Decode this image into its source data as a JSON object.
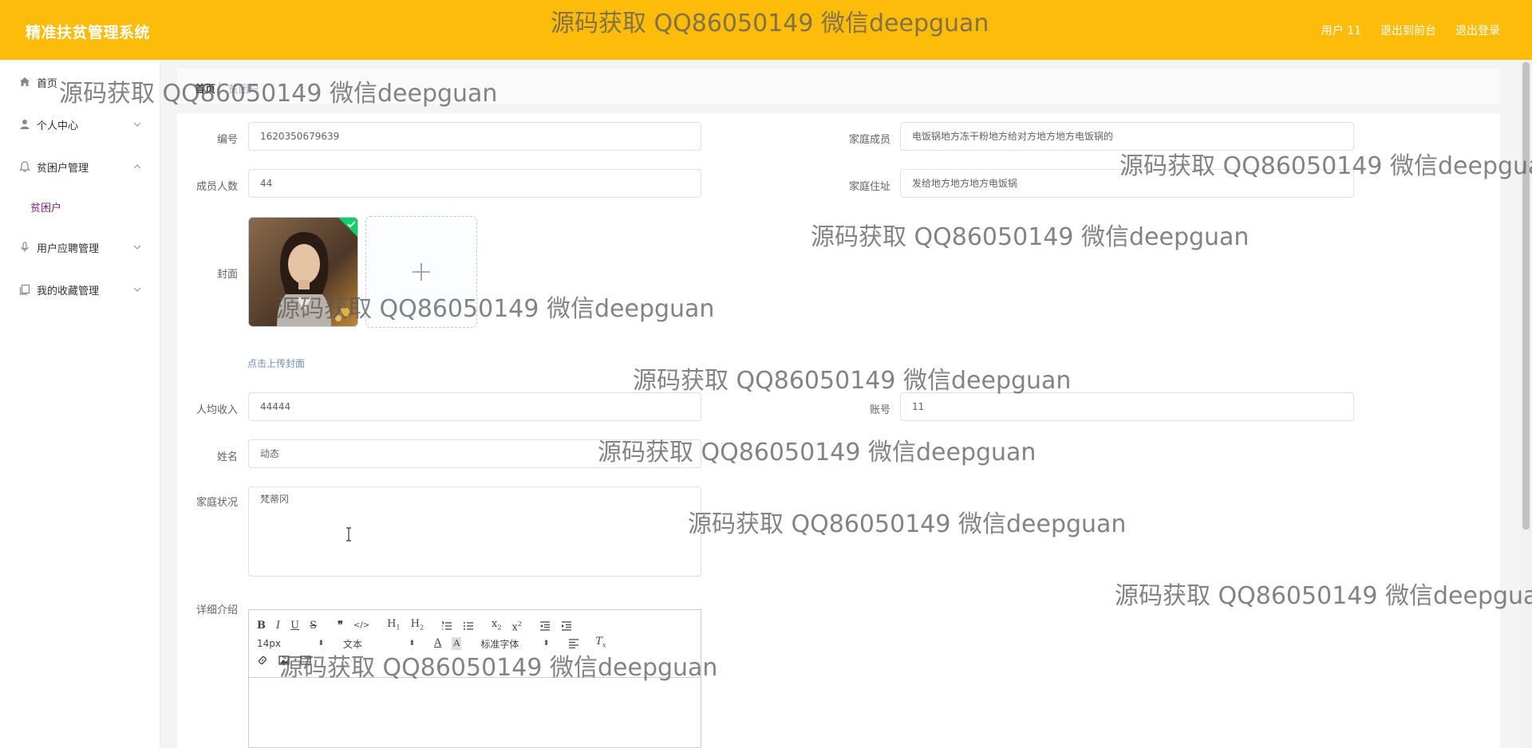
{
  "app": {
    "title": "精准扶贫管理系统"
  },
  "header": {
    "links": [
      {
        "label": "用户 11"
      },
      {
        "label": "退出到前台"
      },
      {
        "label": "退出登录"
      }
    ]
  },
  "sidebar": {
    "items": [
      {
        "label": "首页",
        "icon": "home-icon"
      },
      {
        "label": "个人中心",
        "icon": "user-icon"
      },
      {
        "label": "贫困户管理",
        "icon": "bell-icon",
        "expanded": true,
        "children": [
          {
            "label": "贫困户"
          }
        ]
      },
      {
        "label": "用户应聘管理",
        "icon": "microphone-icon"
      },
      {
        "label": "我的收藏管理",
        "icon": "copy-icon"
      }
    ]
  },
  "breadcrumb": {
    "home": "首页",
    "separator": "/",
    "current": "贫困户"
  },
  "form": {
    "bianhao": {
      "label": "编号",
      "value": "1620350679639"
    },
    "jiating_chengyuan": {
      "label": "家庭成员",
      "value": "电饭锅地方冻干粉地方给对方地方地方电饭锅的"
    },
    "chengyuan_renshu": {
      "label": "成员人数",
      "value": "44"
    },
    "jiating_zhuzhi": {
      "label": "家庭住址",
      "value": "发给地方地方地方电饭锅"
    },
    "fengmian": {
      "label": "封面",
      "upload_text": "点击上传封面"
    },
    "renjun_shouru": {
      "label": "人均收入",
      "value": "44444"
    },
    "zhanghao": {
      "label": "账号",
      "value": "11"
    },
    "xingming": {
      "label": "姓名",
      "value": "动态"
    },
    "jiating_zhuangkuang": {
      "label": "家庭状况",
      "value": "梵蒂冈"
    },
    "xiangxi_jieshao": {
      "label": "详细介绍"
    }
  },
  "editor": {
    "font_size": "14px",
    "paragraph": "文本",
    "font_family": "标准字体",
    "buttons_row1": [
      "B",
      "I",
      "U",
      "S",
      "❞",
      "</>",
      "H1",
      "H2",
      "ol",
      "ul",
      "x₂",
      "x²",
      "outdent",
      "indent"
    ]
  },
  "watermark": "源码获取 QQ86050149 微信deepguan",
  "colors": {
    "header_bg": "#fdbb0a",
    "accent": "#7a1f7f"
  }
}
